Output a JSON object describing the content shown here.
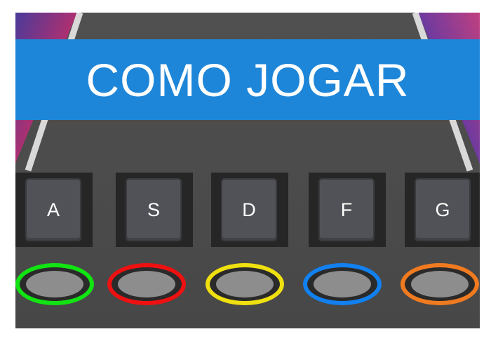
{
  "title": "COMO JOGAR",
  "colors": {
    "banner": "#1e86d8",
    "track": "#4a4a4a",
    "track_edge": "#d9d9d9",
    "key_box": "#262626",
    "key_cap": "#505257",
    "pad": "#8d8d8d"
  },
  "lanes": [
    {
      "key": "A",
      "ring_color": "#12e312"
    },
    {
      "key": "S",
      "ring_color": "#ee1111"
    },
    {
      "key": "D",
      "ring_color": "#f0e010"
    },
    {
      "key": "F",
      "ring_color": "#1280ee"
    },
    {
      "key": "G",
      "ring_color": "#f07a20"
    }
  ]
}
